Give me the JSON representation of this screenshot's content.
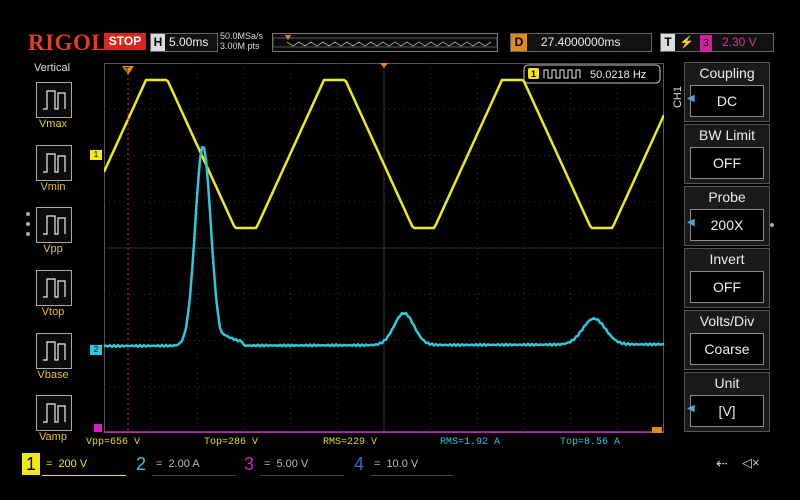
{
  "header": {
    "brand": "RIGOL",
    "run_state": "STOP",
    "h_label": "H",
    "timebase": "5.00ms",
    "sample_rate": "50.0MSa/s",
    "memory_depth": "3.00M pts",
    "delay_label": "D",
    "delay": "27.4000000ms",
    "trigger_label": "T",
    "trigger_source": "3",
    "trigger_level": "2.30 V"
  },
  "left_panel": {
    "title": "Vertical",
    "measurements": [
      "Vmax",
      "Vmin",
      "Vpp",
      "Vtop",
      "Vbase",
      "Vamp"
    ]
  },
  "screen": {
    "frequency_counter": "50.0218 Hz",
    "ch1_marker": "1",
    "ch2_marker": "2",
    "trigger_marker": "T"
  },
  "measure_bar": {
    "vpp": "Vpp=656 V",
    "top1": "Top=286 V",
    "rms1": "RMS=229 V",
    "rms2": "RMS=1.92 A",
    "top2": "Top=8.56 A"
  },
  "right_panel": {
    "channel_tag": "CH1",
    "items": [
      {
        "title": "Coupling",
        "value": "DC"
      },
      {
        "title": "BW Limit",
        "value": "OFF"
      },
      {
        "title": "Probe",
        "value": "200X"
      },
      {
        "title": "Invert",
        "value": "OFF"
      },
      {
        "title": "Volts/Div",
        "value": "Coarse"
      },
      {
        "title": "Unit",
        "value": "[V]"
      }
    ]
  },
  "channels": [
    {
      "num": "1",
      "scale": "200 V",
      "color": "#f0e81a"
    },
    {
      "num": "2",
      "scale": "2.00 A",
      "color": "#2ec8d8"
    },
    {
      "num": "3",
      "scale": "5.00 V",
      "color": "#d020c0"
    },
    {
      "num": "4",
      "scale": "10.0 V",
      "color": "#3a6ad0"
    }
  ],
  "colors": {
    "ch1": "#f0e81a",
    "ch2": "#2ec8d8",
    "ch3": "#d020c0",
    "trigger": "#e08a1a",
    "brand": "#e83a2a"
  }
}
